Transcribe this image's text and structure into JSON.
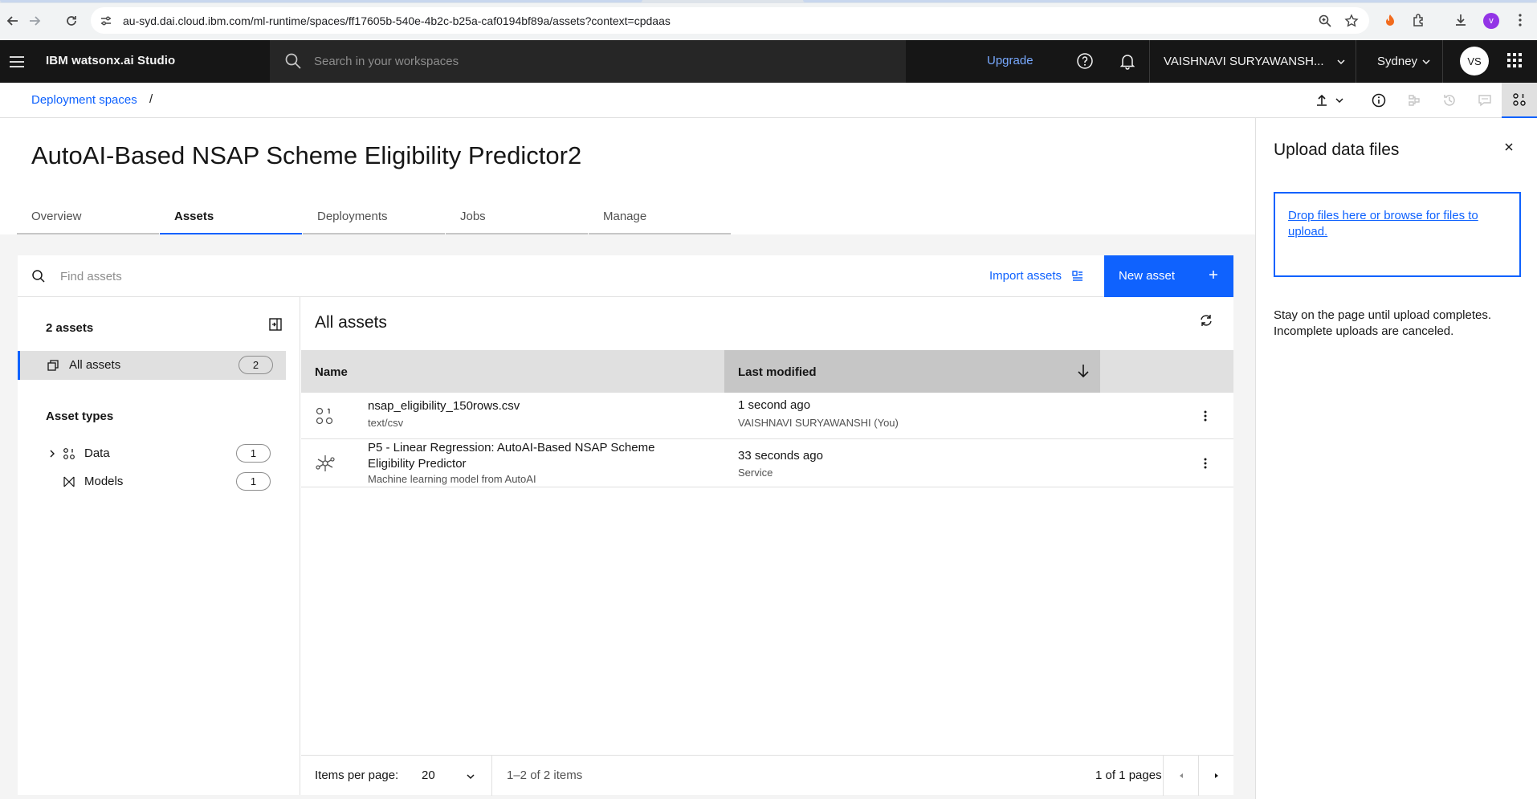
{
  "browser": {
    "url": "au-syd.dai.cloud.ibm.com/ml-runtime/spaces/ff17605b-540e-4b2c-b25a-caf0194bf89a/assets?context=cpdaas",
    "profile_initial": "v"
  },
  "header": {
    "product_name": "IBM watsonx.ai Studio",
    "search_placeholder": "Search in your workspaces",
    "upgrade_label": "Upgrade",
    "account_name": "VAISHNAVI SURYAWANSH...",
    "region": "Sydney",
    "avatar_initials": "VS"
  },
  "breadcrumb": {
    "link": "Deployment spaces",
    "separator": "/"
  },
  "page": {
    "title": "AutoAI-Based NSAP Scheme Eligibility Predictor2",
    "tabs": [
      {
        "label": "Overview"
      },
      {
        "label": "Assets"
      },
      {
        "label": "Deployments"
      },
      {
        "label": "Jobs"
      },
      {
        "label": "Manage"
      }
    ]
  },
  "assets": {
    "find_placeholder": "Find assets",
    "import_label": "Import assets",
    "new_asset_label": "New asset",
    "count_label": "2 assets",
    "all_assets_label": "All assets",
    "all_assets_count": "2",
    "asset_types_heading": "Asset types",
    "types": [
      {
        "label": "Data",
        "count": "1"
      },
      {
        "label": "Models",
        "count": "1"
      }
    ],
    "panel_title": "All assets",
    "columns": {
      "name": "Name",
      "last_modified": "Last modified"
    },
    "rows": [
      {
        "name": "nsap_eligibility_150rows.csv",
        "sub": "text/csv",
        "when": "1 second ago",
        "who": "VAISHNAVI SURYAWANSHI (You)",
        "icon": "data-asset-icon"
      },
      {
        "name": "P5 - Linear Regression: AutoAI-Based NSAP Scheme Eligibility Predictor",
        "sub": "Machine learning model from AutoAI",
        "when": "33 seconds ago",
        "who": "Service",
        "icon": "model-asset-icon"
      }
    ],
    "pager": {
      "items_per_page_label": "Items per page:",
      "items_per_page": "20",
      "range": "1–2 of 2 items",
      "pages": "1 of 1 pages"
    }
  },
  "upload_panel": {
    "title": "Upload data files",
    "drop_text": "Drop files here or browse for files to upload.",
    "note": "Stay on the page until upload completes. Incomplete uploads are canceled."
  },
  "colors": {
    "accent": "#0f62fe",
    "header_bg": "#161616",
    "link_header": "#78a9ff"
  }
}
